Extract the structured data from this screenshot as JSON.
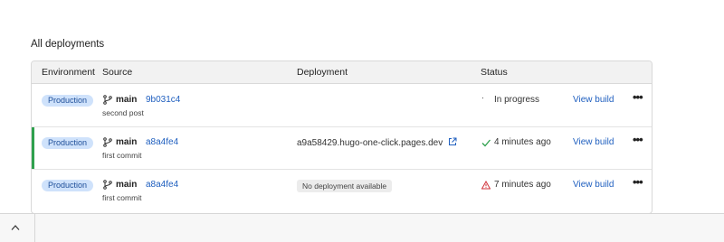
{
  "section_title": "All deployments",
  "columns": [
    "Environment",
    "Source",
    "Deployment",
    "Status"
  ],
  "rows": [
    {
      "environment": "Production",
      "branch": "main",
      "commit_hash": "9b031c4",
      "commit_message": "second post",
      "deployment": "",
      "status": "In progress",
      "status_icon": "spinner-icon",
      "action": "View build",
      "more": "•••"
    },
    {
      "environment": "Production",
      "branch": "main",
      "commit_hash": "a8a4fe4",
      "commit_message": "first commit",
      "deployment": "a9a58429.hugo-one-click.pages.dev",
      "status": "4 minutes ago",
      "status_icon": "check-icon",
      "action": "View build",
      "more": "•••"
    },
    {
      "environment": "Production",
      "branch": "main",
      "commit_hash": "a8a4fe4",
      "commit_message": "first commit",
      "deployment": "No deployment available",
      "status": "7 minutes ago",
      "status_icon": "warning-icon",
      "action": "View build",
      "more": "•••"
    }
  ],
  "colors": {
    "accent": "#1f5fbf",
    "success": "#2fa04d",
    "error": "#d0323a",
    "badge_bg": "#cfe2fb"
  }
}
